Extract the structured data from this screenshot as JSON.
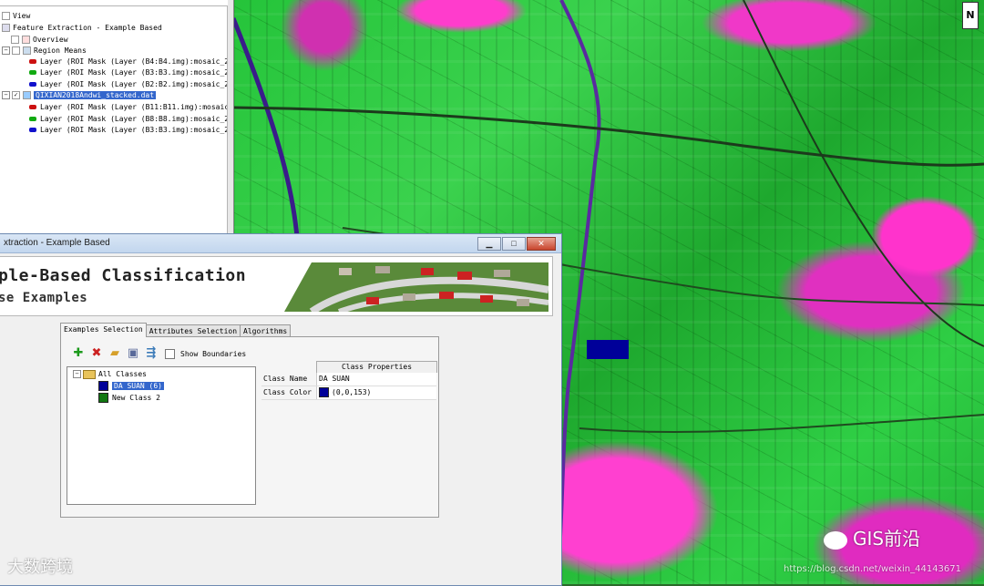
{
  "layer_tree": {
    "items": [
      {
        "label": "View",
        "indent": 0,
        "icon": "view-icon"
      },
      {
        "label": "Feature Extraction - Example Based",
        "indent": 0,
        "icon": "feature-icon"
      },
      {
        "label": "Overview",
        "indent": 1,
        "icon": "overview-icon"
      },
      {
        "label": "Region Means",
        "indent": 1,
        "icon": "region-icon"
      },
      {
        "label": "Layer (ROI Mask (Layer (B4:B4.img):mosaic_20",
        "indent": 2,
        "color": "#cc1111"
      },
      {
        "label": "Layer (ROI Mask (Layer (B3:B3.img):mosaic_20",
        "indent": 2,
        "color": "#11aa11"
      },
      {
        "label": "Layer (ROI Mask (Layer (B2:B2.img):mosaic_20",
        "indent": 2,
        "color": "#1111cc"
      },
      {
        "label": "QIXIAN2018Andwi_stacked.dat",
        "indent": 1,
        "icon": "raster-icon",
        "selected": true
      },
      {
        "label": "Layer (ROI Mask (Layer (B11:B11.img):mosaic_",
        "indent": 2,
        "color": "#cc1111"
      },
      {
        "label": "Layer (ROI Mask (Layer (B8:B8.img):mosaic_20",
        "indent": 2,
        "color": "#11aa11"
      },
      {
        "label": "Layer (ROI Mask (Layer (B3:B3.img):mosaic_20",
        "indent": 2,
        "color": "#1111cc"
      }
    ]
  },
  "dialog": {
    "title": "xtraction - Example Based",
    "banner_title": "ple-Based Classification",
    "banner_subtitle": "se Examples",
    "tabs": [
      "Examples Selection",
      "Attributes Selection",
      "Algorithms"
    ],
    "active_tab": 0,
    "toolbar": {
      "show_boundaries_label": "Show Boundaries",
      "show_boundaries_checked": false
    },
    "class_tree": {
      "root": "All Classes",
      "classes": [
        {
          "label": "DA SUAN (6)",
          "color": "#000099",
          "selected": true
        },
        {
          "label": "New Class 2",
          "color": "#117711",
          "selected": false
        }
      ]
    },
    "properties": {
      "header": "Class Properties",
      "rows": [
        {
          "label": "Class Name",
          "value": "DA SUAN"
        },
        {
          "label": "Class Color",
          "value": "(0,0,153)",
          "color": "#000099"
        }
      ]
    }
  },
  "map": {
    "north_label": "N"
  },
  "watermarks": {
    "left": "大数跨境",
    "right": "GIS前沿",
    "url": "https://blog.csdn.net/weixin_44143671"
  },
  "colors": {
    "selection": "#3366cc",
    "title_bar": "#c2d6ee",
    "vegetation": "#2fcf45",
    "urban": "#ff33cc"
  }
}
